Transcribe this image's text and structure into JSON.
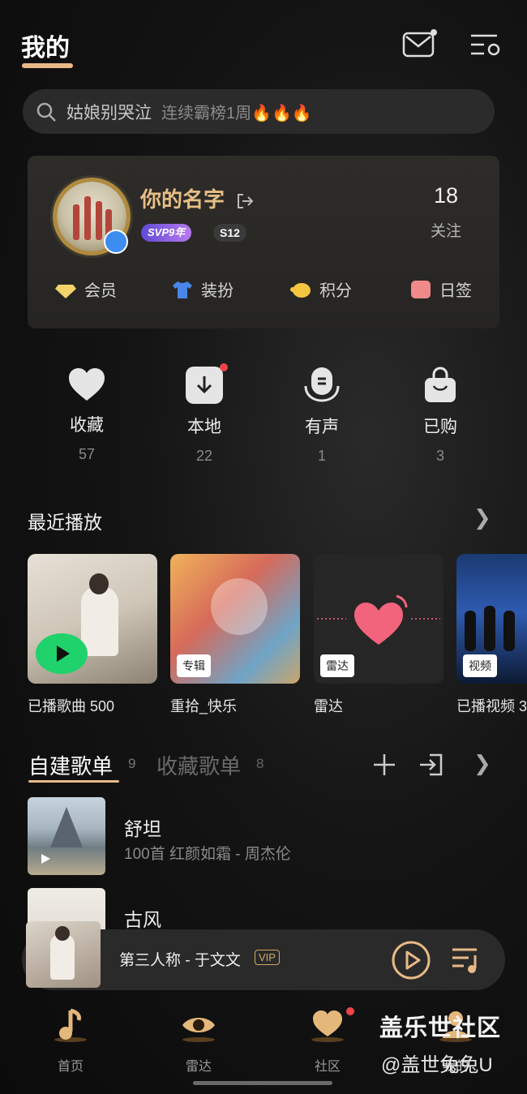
{
  "header": {
    "title": "我的"
  },
  "search": {
    "query": "姑娘别哭泣",
    "hint": "连续霸榜1周🔥🔥🔥"
  },
  "profile": {
    "name": "你的名字",
    "svp_badge": "SVP9年",
    "level_badge": "S12",
    "follow_count": "18",
    "follow_label": "关注",
    "perks": [
      {
        "label": "会员",
        "icon": "diamond-icon",
        "color": "#f3d36a"
      },
      {
        "label": "装扮",
        "icon": "shirt-icon",
        "color": "#4a86e8"
      },
      {
        "label": "积分",
        "icon": "piggy-icon",
        "color": "#f5c542"
      },
      {
        "label": "日签",
        "icon": "calendar-icon",
        "color": "#f08a8a"
      }
    ]
  },
  "stats": [
    {
      "label": "收藏",
      "count": "57",
      "icon": "heart-icon"
    },
    {
      "label": "本地",
      "count": "22",
      "icon": "download-icon"
    },
    {
      "label": "有声",
      "count": "1",
      "icon": "audiobook-icon"
    },
    {
      "label": "已购",
      "count": "3",
      "icon": "bag-icon"
    }
  ],
  "recent": {
    "title": "最近播放",
    "items": [
      {
        "caption": "已播歌曲 500",
        "tag": ""
      },
      {
        "caption": "重拾_快乐",
        "tag": "专辑"
      },
      {
        "caption": "雷达",
        "tag": "雷达"
      },
      {
        "caption": "已播视频 3",
        "tag": "视频"
      }
    ]
  },
  "playlists": {
    "tab_created": "自建歌单",
    "tab_created_count": "9",
    "tab_collected": "收藏歌单",
    "tab_collected_count": "8",
    "items": [
      {
        "name": "舒坦",
        "sub": "100首 红颜如霜 - 周杰伦"
      },
      {
        "name": "古风",
        "sub": ""
      }
    ]
  },
  "player": {
    "now_playing": "第三人称 - 于文文",
    "vip": "VIP"
  },
  "nav": [
    {
      "label": "首页",
      "icon": "music-note-icon"
    },
    {
      "label": "雷达",
      "icon": "eye-icon"
    },
    {
      "label": "社区",
      "icon": "heart-chat-icon"
    },
    {
      "label": "我的",
      "icon": "profile-icon"
    }
  ],
  "watermark": {
    "line1": "盖乐世社区",
    "line2": "@盖世兔兔U"
  },
  "colors": {
    "accent": "#e8b987",
    "background": "#0f0f0f",
    "badge_red": "#f0434c"
  }
}
